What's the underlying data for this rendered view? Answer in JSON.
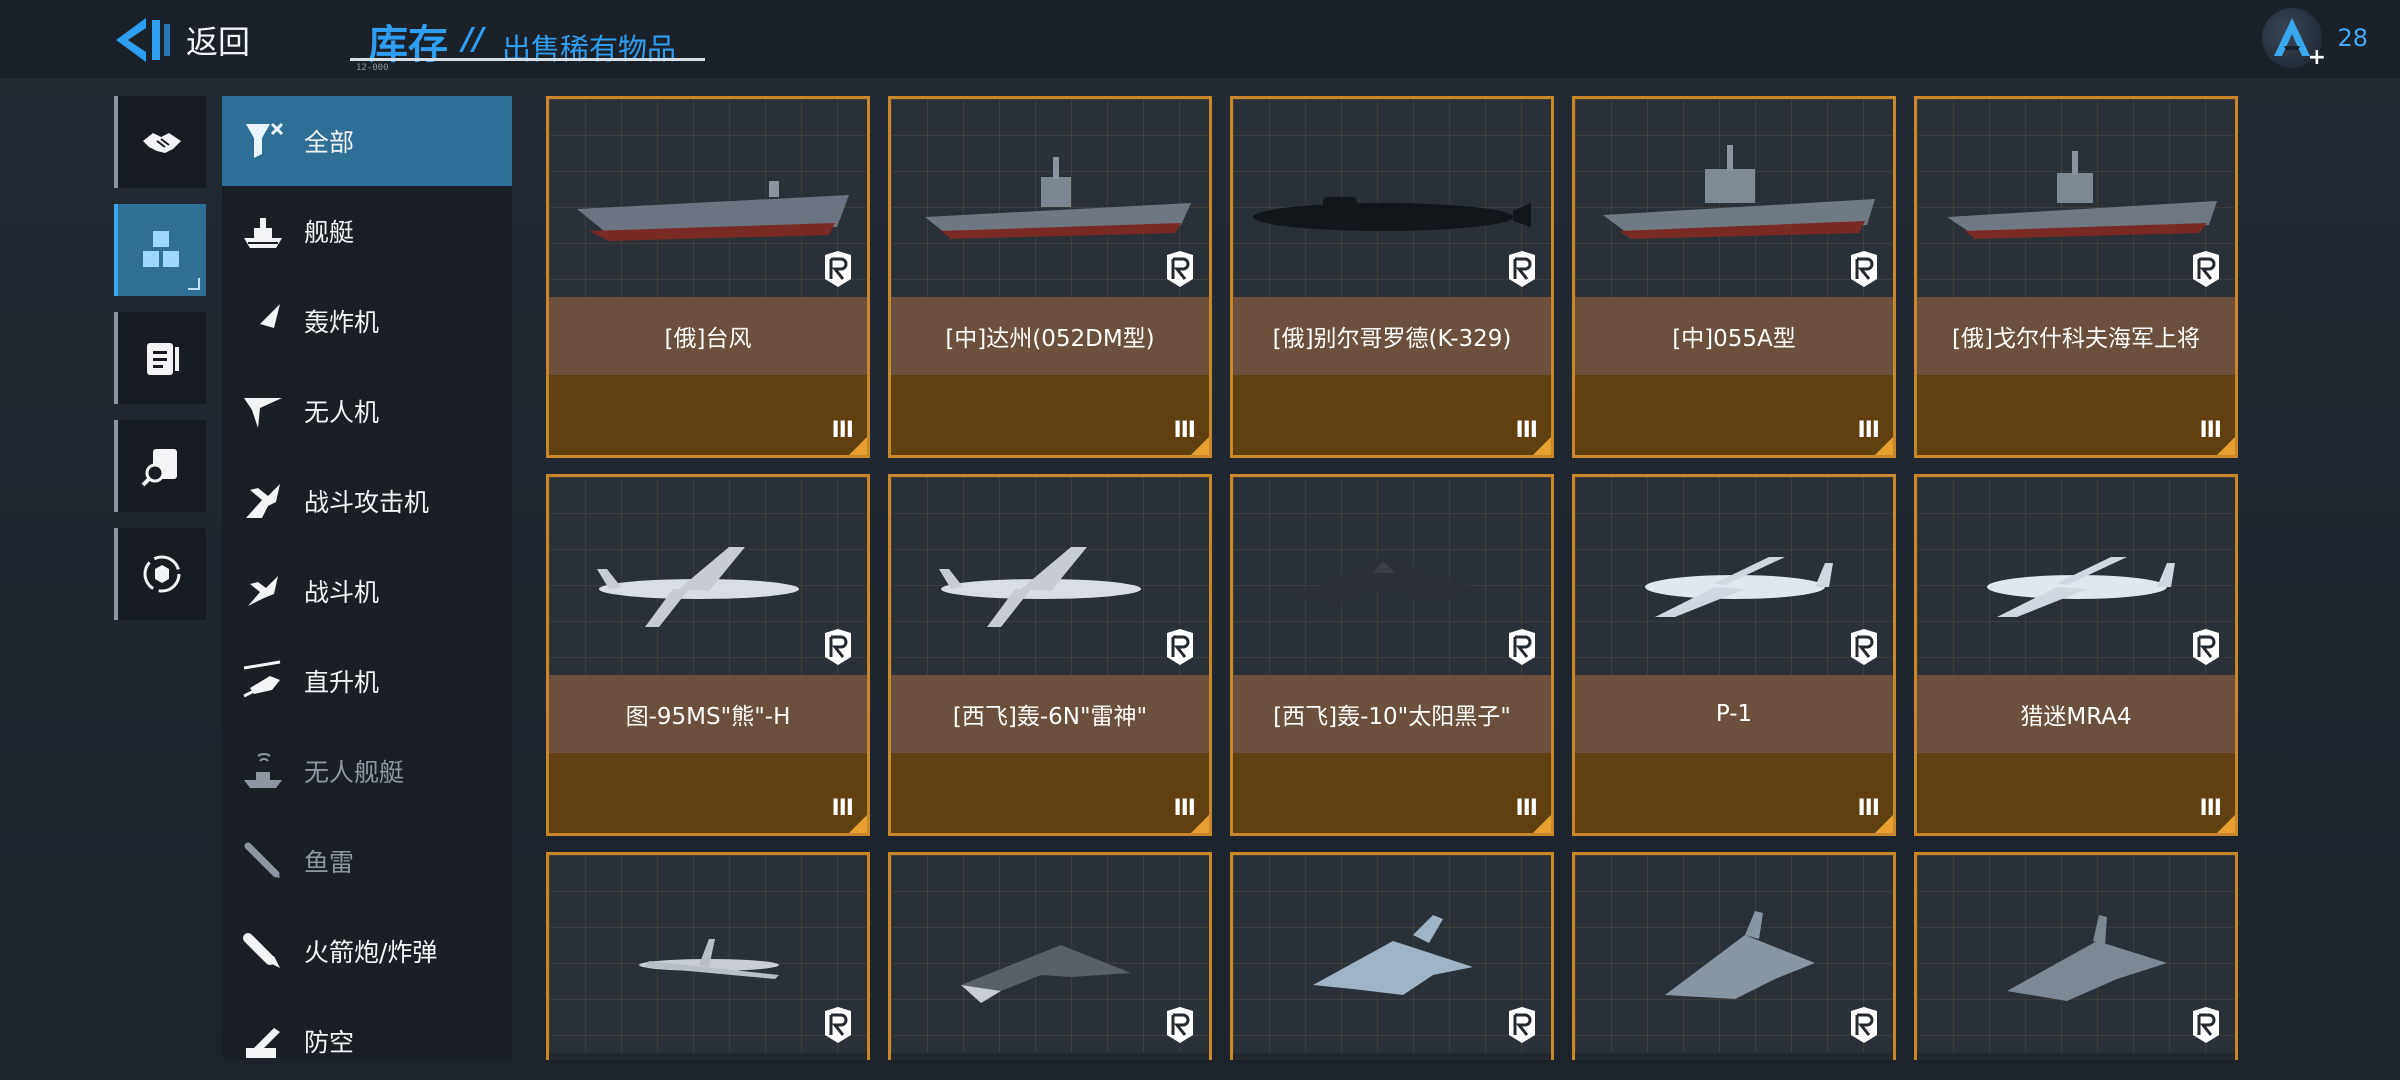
{
  "header": {
    "back_label": "返回",
    "title": "库存",
    "separator": "//",
    "subtitle": "出售稀有物品",
    "tiny_code": "12-000",
    "user_count": "28"
  },
  "rail": [
    {
      "icon": "handshake-icon",
      "active": false
    },
    {
      "icon": "inventory-cubes-icon",
      "active": true
    },
    {
      "icon": "document-list-icon",
      "active": false
    },
    {
      "icon": "search-document-icon",
      "active": false
    },
    {
      "icon": "exchange-cycle-icon",
      "active": false
    }
  ],
  "categories": [
    {
      "label": "全部",
      "icon": "filter-all-icon",
      "active": true,
      "dim": false
    },
    {
      "label": "舰艇",
      "icon": "warship-icon",
      "active": false,
      "dim": false
    },
    {
      "label": "轰炸机",
      "icon": "bomber-icon",
      "active": false,
      "dim": false
    },
    {
      "label": "无人机",
      "icon": "drone-icon",
      "active": false,
      "dim": false
    },
    {
      "label": "战斗攻击机",
      "icon": "strike-fighter-icon",
      "active": false,
      "dim": false
    },
    {
      "label": "战斗机",
      "icon": "fighter-icon",
      "active": false,
      "dim": false
    },
    {
      "label": "直升机",
      "icon": "helicopter-icon",
      "active": false,
      "dim": false
    },
    {
      "label": "无人舰艇",
      "icon": "unmanned-boat-icon",
      "active": false,
      "dim": true
    },
    {
      "label": "鱼雷",
      "icon": "torpedo-icon",
      "active": false,
      "dim": true
    },
    {
      "label": "火箭炮/炸弹",
      "icon": "rocket-bomb-icon",
      "active": false,
      "dim": false
    },
    {
      "label": "防空",
      "icon": "air-defense-icon",
      "active": false,
      "dim": false
    }
  ],
  "items": [
    {
      "name": "[俄]台风",
      "kind": "carrier",
      "tier": "III",
      "rarity": "R"
    },
    {
      "name": "[中]达州(052DM型)",
      "kind": "destroyer",
      "tier": "III",
      "rarity": "R"
    },
    {
      "name": "[俄]别尔哥罗德(K-329)",
      "kind": "submarine",
      "tier": "III",
      "rarity": "R"
    },
    {
      "name": "[中]055A型",
      "kind": "cruiser",
      "tier": "III",
      "rarity": "R"
    },
    {
      "name": "[俄]戈尔什科夫海军上将",
      "kind": "frigate",
      "tier": "III",
      "rarity": "R"
    },
    {
      "name": "图-95MS\"熊\"-H",
      "kind": "bomber",
      "tier": "III",
      "rarity": "R"
    },
    {
      "name": "[西飞]轰-6N\"雷神\"",
      "kind": "bomber",
      "tier": "III",
      "rarity": "R"
    },
    {
      "name": "[西飞]轰-10\"太阳黑子\"",
      "kind": "flyingwing",
      "tier": "III",
      "rarity": "R"
    },
    {
      "name": "P-1",
      "kind": "patrol",
      "tier": "III",
      "rarity": "R"
    },
    {
      "name": "猎迷MRA4",
      "kind": "patrol",
      "tier": "III",
      "rarity": "R"
    },
    {
      "name": "",
      "kind": "drone",
      "tier": "",
      "rarity": "R"
    },
    {
      "name": "",
      "kind": "ucav",
      "tier": "",
      "rarity": "R"
    },
    {
      "name": "",
      "kind": "fighter",
      "tier": "",
      "rarity": "R"
    },
    {
      "name": "",
      "kind": "fighter2",
      "tier": "",
      "rarity": "R"
    },
    {
      "name": "",
      "kind": "fighter3",
      "tier": "",
      "rarity": "R"
    }
  ],
  "colors": {
    "accent": "#2f9df0",
    "card_border": "#c7882c",
    "name_bar": "#6b513d",
    "footer": "#614010",
    "active_category": "#2e6f98"
  }
}
